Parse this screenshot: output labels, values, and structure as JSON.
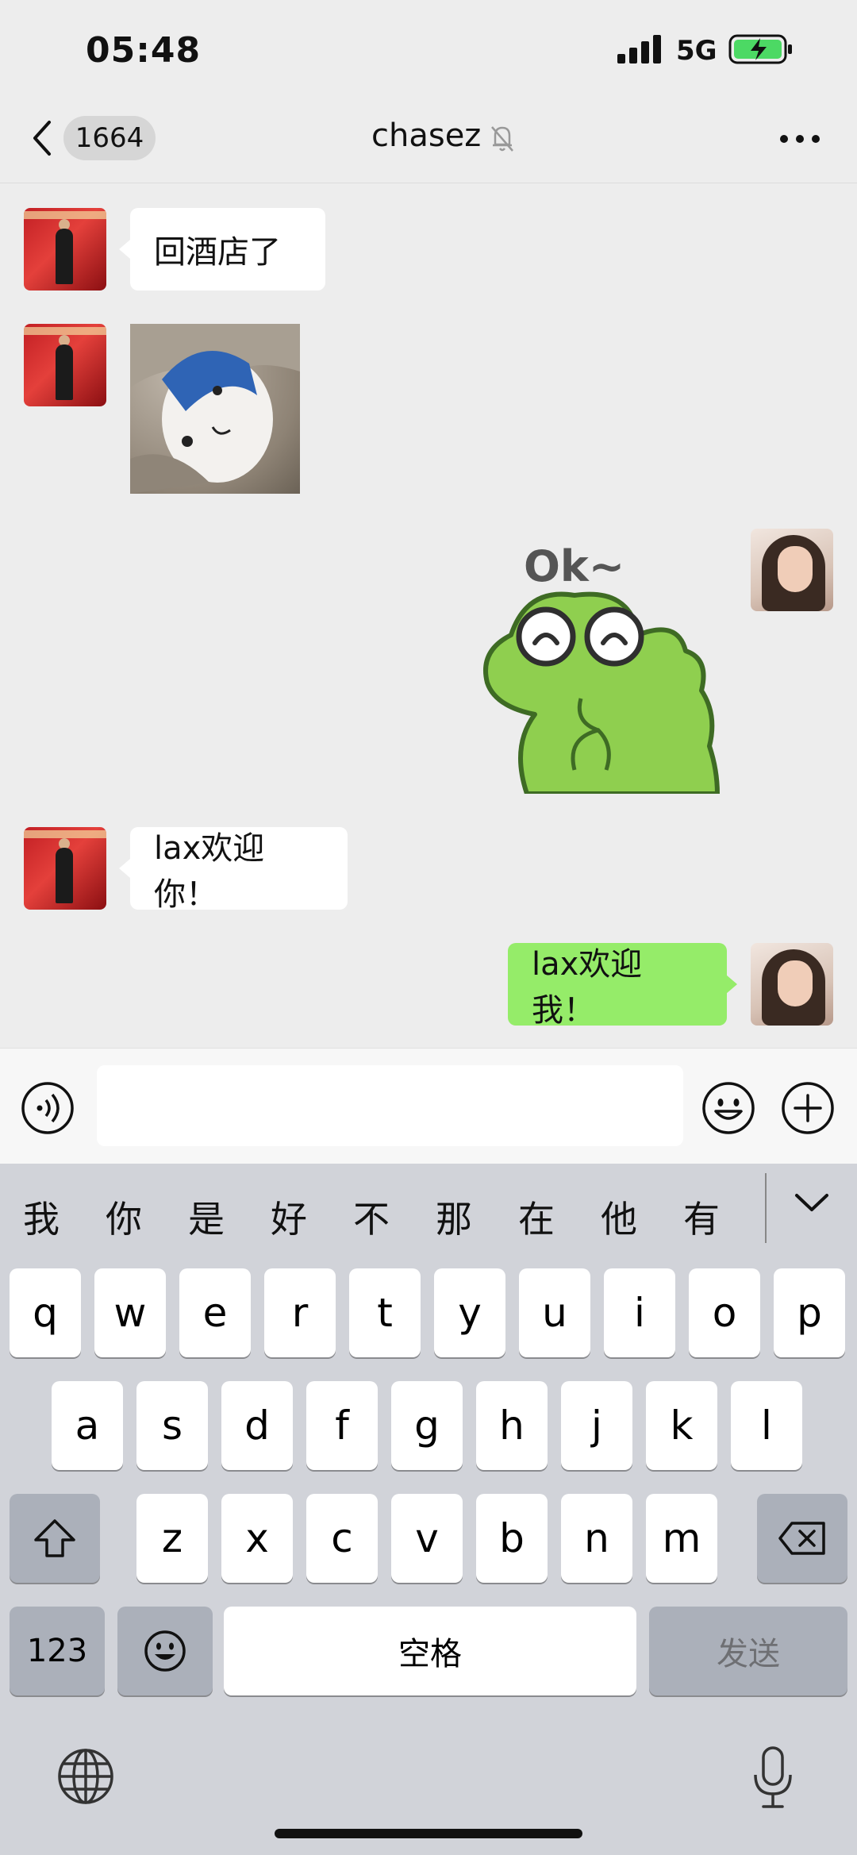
{
  "status_bar": {
    "time": "05:48",
    "network": "5G"
  },
  "nav": {
    "unread_count": "1664",
    "title": "chasez"
  },
  "messages": [
    {
      "side": "left",
      "type": "text",
      "text": "回酒店了"
    },
    {
      "side": "left",
      "type": "image",
      "icon": "plush-photo"
    },
    {
      "side": "right",
      "type": "sticker",
      "text": "Ok~"
    },
    {
      "side": "left",
      "type": "text",
      "text": "lax欢迎你！"
    },
    {
      "side": "right",
      "type": "text",
      "text": "lax欢迎我！"
    }
  ],
  "input_bar": {
    "value": "",
    "placeholder": ""
  },
  "keyboard": {
    "candidates": [
      "我",
      "你",
      "是",
      "好",
      "不",
      "那",
      "在",
      "他",
      "有"
    ],
    "row1": [
      "q",
      "w",
      "e",
      "r",
      "t",
      "y",
      "u",
      "i",
      "o",
      "p"
    ],
    "row2": [
      "a",
      "s",
      "d",
      "f",
      "g",
      "h",
      "j",
      "k",
      "l"
    ],
    "row3": [
      "z",
      "x",
      "c",
      "v",
      "b",
      "n",
      "m"
    ],
    "numbers_key": "123",
    "space_key": "空格",
    "send_key": "发送"
  },
  "colors": {
    "sent_bubble": "#95ec69",
    "received_bubble": "#ffffff",
    "background": "#ededed"
  }
}
